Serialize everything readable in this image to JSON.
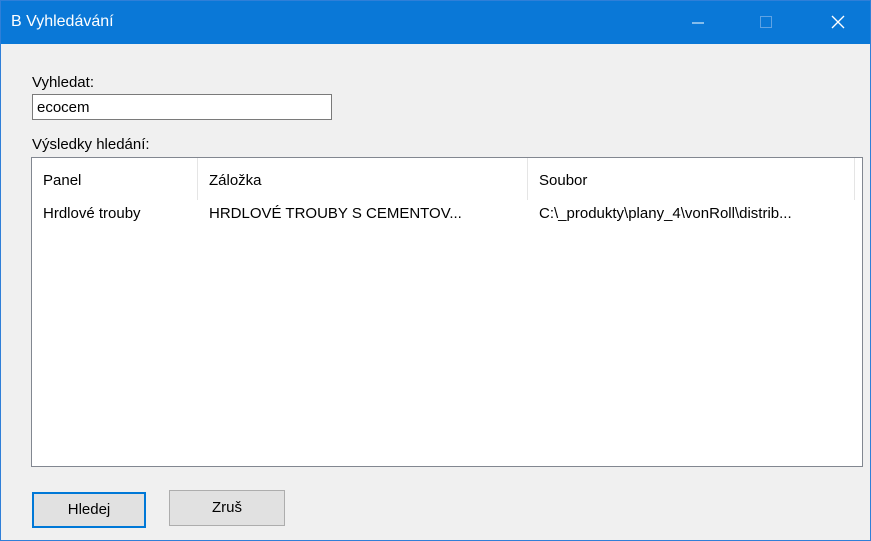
{
  "window": {
    "title": "B Vyhledávání"
  },
  "search": {
    "label": "Vyhledat:",
    "value": "ecocem"
  },
  "results": {
    "label": "Výsledky hledání:",
    "columns": [
      "Panel",
      "Záložka",
      "Soubor"
    ],
    "rows": [
      {
        "panel": "Hrdlové trouby",
        "zalozka": "HRDLOVÉ TROUBY S CEMENTOV...",
        "soubor": "C:\\_produkty\\plany_4\\vonRoll\\distrib..."
      }
    ]
  },
  "buttons": {
    "search_label": "Hledej",
    "cancel_label": "Zruš"
  },
  "colors": {
    "titlebar": "#0a78d7",
    "focus_border": "#0078d7"
  },
  "icons": {
    "minimize": "minimize-icon",
    "maximize": "maximize-icon",
    "close": "close-icon"
  }
}
